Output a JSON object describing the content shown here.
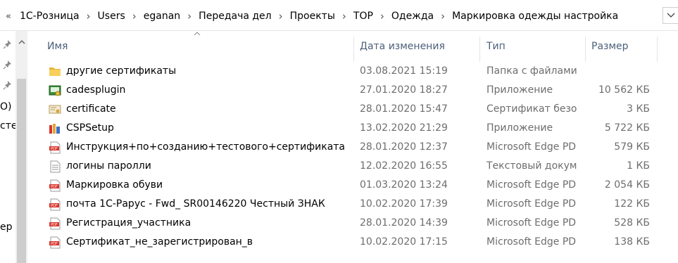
{
  "address": {
    "overflow": "«",
    "crumbs": [
      "1С-Розница",
      "Users",
      "eganan",
      "Передача дел",
      "Проекты",
      "TOP",
      "Одежда",
      "Маркировка одежды настройка"
    ],
    "dropdown_icon": "chevron-down-icon"
  },
  "nav": {
    "cut_labels": [
      "О)",
      "сте",
      "ер"
    ]
  },
  "columns": {
    "name": "Имя",
    "date": "Дата изменения",
    "type": "Тип",
    "size": "Размер"
  },
  "files": [
    {
      "name": "другие сертификаты",
      "date": "03.08.2021 15:19",
      "type": "Папка с файлами",
      "size": "",
      "icon": "folder-icon"
    },
    {
      "name": "cadesplugin",
      "date": "27.01.2020 18:27",
      "type": "Приложение",
      "size": "10 562 КБ",
      "icon": "installer-icon"
    },
    {
      "name": "certificate",
      "date": "28.01.2020 15:47",
      "type": "Сертификат безо...",
      "size": "3 КБ",
      "icon": "certificate-icon"
    },
    {
      "name": "CSPSetup",
      "date": "13.02.2020 21:29",
      "type": "Приложение",
      "size": "5 722 КБ",
      "icon": "setup-icon"
    },
    {
      "name": "Инструкция+по+созданию+тестового+сертификата",
      "date": "28.01.2020 12:37",
      "type": "Microsoft Edge PD...",
      "size": "579 КБ",
      "icon": "pdf-icon"
    },
    {
      "name": "логины паролли",
      "date": "12.02.2020 16:55",
      "type": "Текстовый докум...",
      "size": "1 КБ",
      "icon": "text-file-icon"
    },
    {
      "name": "Маркировка обуви",
      "date": "01.03.2020 13:24",
      "type": "Microsoft Edge PD...",
      "size": "2 054 КБ",
      "icon": "pdf-icon"
    },
    {
      "name": "почта 1С-Рарус - Fwd_ SR00146220 Честный ЗНАК",
      "date": "10.02.2020 17:39",
      "type": "Microsoft Edge PD...",
      "size": "122 КБ",
      "icon": "pdf-icon"
    },
    {
      "name": "Регистрация_участника",
      "date": "28.01.2020 14:39",
      "type": "Microsoft Edge PD...",
      "size": "528 КБ",
      "icon": "pdf-icon"
    },
    {
      "name": "Сертификат_не_зарегистрирован_в",
      "date": "10.02.2020 17:15",
      "type": "Microsoft Edge PD...",
      "size": "138 КБ",
      "icon": "pdf-icon"
    }
  ],
  "colors": {
    "header_text": "#4c607a",
    "muted_text": "#6d6d6d",
    "folder": "#f5c54a",
    "pdf": "#d9342b"
  }
}
